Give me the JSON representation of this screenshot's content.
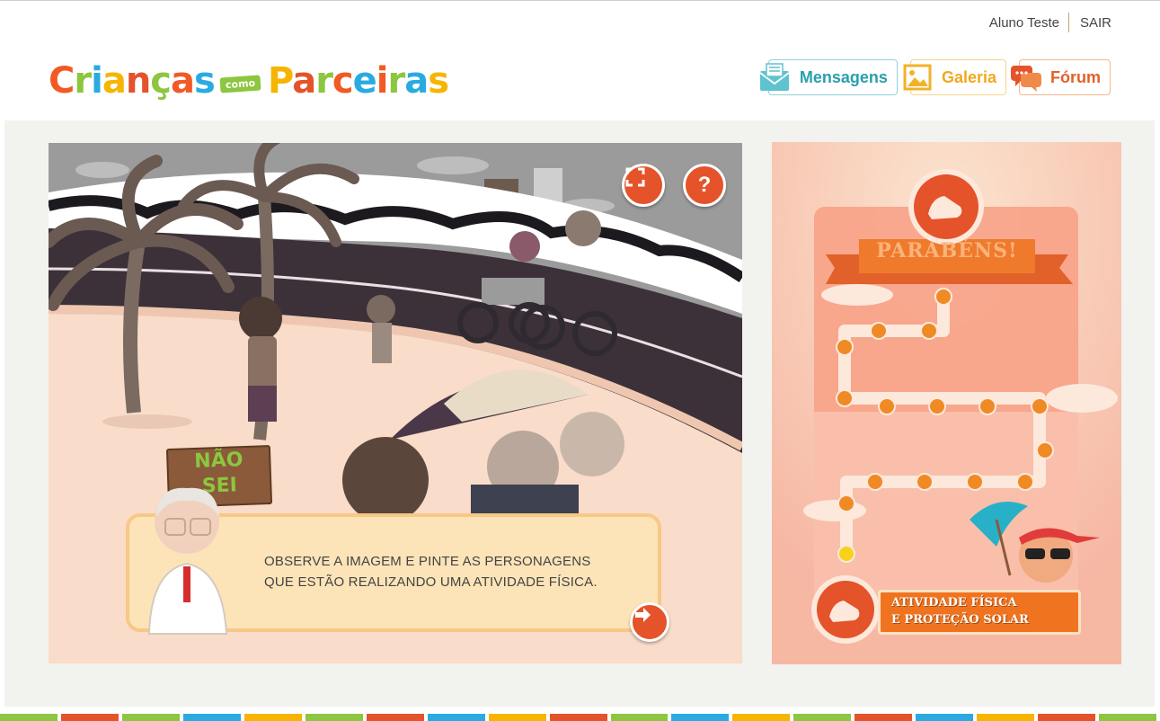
{
  "user": {
    "name": "Aluno Teste",
    "logout": "SAIR"
  },
  "logo": {
    "text_part1": "Crianças",
    "text_como": "como",
    "text_part2": "Parceiras",
    "letter_colors": [
      "#f15a24",
      "#8dc63f",
      "#29abe2",
      "#f7b400",
      "#e4532a",
      "#8dc63f",
      "#f15a24",
      "#29abe2"
    ]
  },
  "nav": {
    "messages": {
      "label": "Mensagens",
      "icon": "envelope-icon",
      "color": "#2a9fae"
    },
    "gallery": {
      "label": "Galeria",
      "icon": "picture-frame-icon",
      "color": "#f1a91f"
    },
    "forum": {
      "label": "Fórum",
      "icon": "chat-bubbles-icon",
      "color": "#e0622a"
    }
  },
  "activity": {
    "fullscreen_icon": "fullscreen-icon",
    "help_label": "?",
    "sign_text": [
      "NÃO",
      "SEI"
    ],
    "instruction": "Observe a imagem e pinte as personagens que estão realizando uma atividade física.",
    "next_icon": "arrow-right-icon"
  },
  "progress": {
    "banner": "PARABÉNS!",
    "badge_icon": "sneaker-icon",
    "module_title": "ATIVIDADE FÍSICA E PROTEÇÃO SOLAR",
    "module_title_lines": [
      "ATIVIDADE FÍSICA",
      "E PROTEÇÃO SOLAR"
    ],
    "steps_total": 16,
    "current_step_color": "#f7d21c",
    "completed_step_color": "#f08a24"
  },
  "footer_colors": [
    "#8dc63f",
    "#e4532a",
    "#8dc63f",
    "#29abe2",
    "#f7b400",
    "#8dc63f",
    "#e4532a",
    "#29abe2",
    "#f7b400",
    "#e4532a",
    "#8dc63f",
    "#29abe2",
    "#f7b400",
    "#8dc63f",
    "#e4532a",
    "#29abe2",
    "#f7b400",
    "#e4532a",
    "#8dc63f"
  ]
}
